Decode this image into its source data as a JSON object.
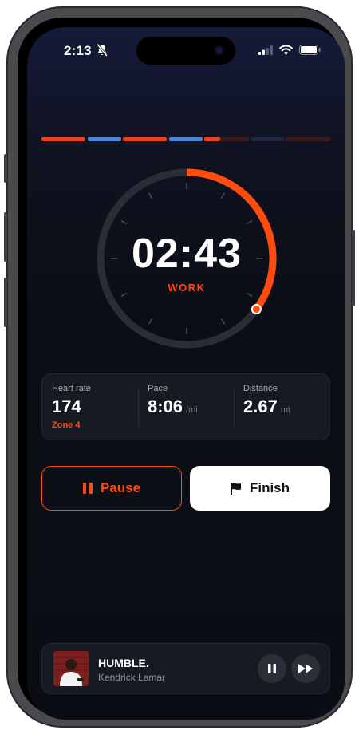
{
  "status_bar": {
    "time": "2:13"
  },
  "interval_progress": {
    "segments": [
      {
        "type": "work",
        "state": "done",
        "color": "#e8431c"
      },
      {
        "type": "rest",
        "state": "done",
        "color": "#4d86d6"
      },
      {
        "type": "work",
        "state": "done",
        "color": "#e8431c"
      },
      {
        "type": "rest",
        "state": "done",
        "color": "#4d86d6"
      },
      {
        "type": "work",
        "state": "current",
        "fraction": 0.35,
        "color": "#e8431c"
      },
      {
        "type": "rest",
        "state": "upcoming",
        "color": "#1e2840"
      },
      {
        "type": "work",
        "state": "upcoming",
        "color": "#3a1c1e"
      }
    ]
  },
  "timer": {
    "time": "02:43",
    "phase": "WORK",
    "progress": 0.35,
    "accent": "#ff4a10"
  },
  "stats": {
    "heart_rate": {
      "label": "Heart rate",
      "value": "174",
      "zone": "Zone 4"
    },
    "pace": {
      "label": "Pace",
      "value": "8:06",
      "unit": "/mi"
    },
    "distance": {
      "label": "Distance",
      "value": "2.67",
      "unit": "mi"
    }
  },
  "controls": {
    "pause_label": "Pause",
    "finish_label": "Finish"
  },
  "now_playing": {
    "title": "HUMBLE.",
    "artist": "Kendrick Lamar"
  }
}
